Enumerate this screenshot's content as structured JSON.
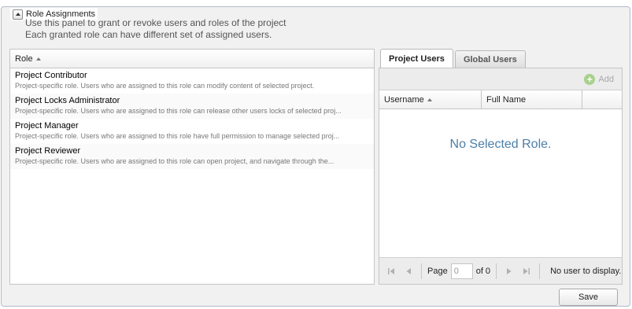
{
  "panel": {
    "title": "Role Assignments",
    "description_line1": "Use this panel to grant or revoke users and roles of the project",
    "description_line2": "Each granted role can have different set of assigned users."
  },
  "roles_grid": {
    "column_header": "Role",
    "rows": [
      {
        "name": "Project Contributor",
        "description": "Project-specific role. Users who are assigned to this role can modify content of selected project."
      },
      {
        "name": "Project Locks Administrator",
        "description": "Project-specific role. Users who are assigned to this role can release other users locks of selected proj..."
      },
      {
        "name": "Project Manager",
        "description": "Project-specific role. Users who are assigned to this role have full permission to manage selected proj..."
      },
      {
        "name": "Project Reviewer",
        "description": "Project-specific role. Users who are assigned to this role can open project, and navigate through the..."
      }
    ]
  },
  "tabs": [
    {
      "label": "Project Users",
      "active": true
    },
    {
      "label": "Global Users",
      "active": false
    }
  ],
  "users_grid": {
    "add_label": "Add",
    "columns": [
      "Username",
      "Full Name"
    ],
    "empty_message": "No Selected Role."
  },
  "paging": {
    "page_label": "Page",
    "page_value": "0",
    "of_label": "of 0",
    "display_message": "No user to display."
  },
  "footer": {
    "save_label": "Save"
  }
}
